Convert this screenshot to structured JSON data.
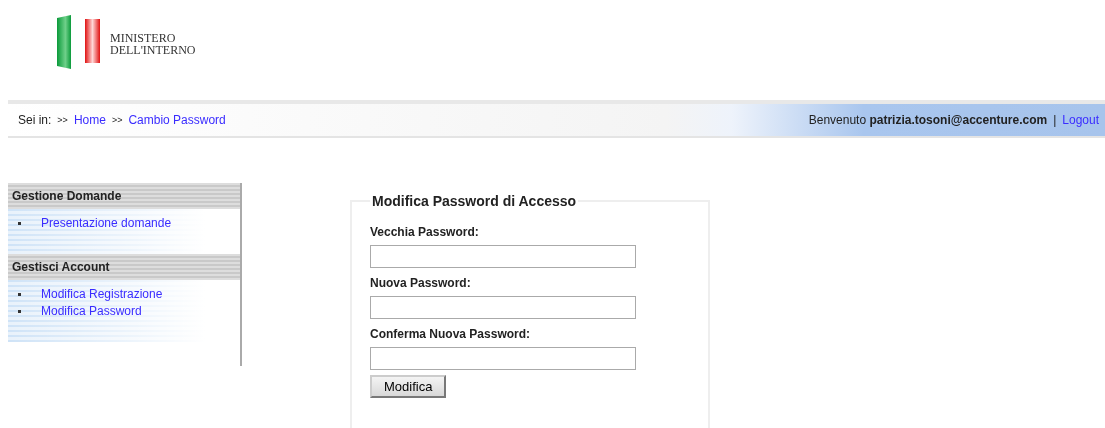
{
  "header": {
    "logo_lines": [
      "MINISTERO",
      "DELL'INTERNO"
    ]
  },
  "breadcrumb": {
    "label": "Sei in:",
    "items": [
      {
        "separator": ">>",
        "text": "Home"
      },
      {
        "separator": ">>",
        "text": "Cambio Password"
      }
    ]
  },
  "user_bar": {
    "welcome": "Benvenuto",
    "user": "patrizia.tosoni@accenture.com",
    "separator": "|",
    "logout": "Logout"
  },
  "sidebar": {
    "sections": [
      {
        "title": "Gestione Domande",
        "items": [
          "Presentazione domande"
        ]
      },
      {
        "title": "Gestisci Account",
        "items": [
          "Modifica Registrazione",
          "Modifica Password"
        ]
      }
    ]
  },
  "form": {
    "legend": "Modifica Password di Accesso",
    "fields": [
      {
        "label": "Vecchia Password:"
      },
      {
        "label": "Nuova Password:"
      },
      {
        "label": "Conferma Nuova Password:"
      }
    ],
    "submit": "Modifica"
  }
}
